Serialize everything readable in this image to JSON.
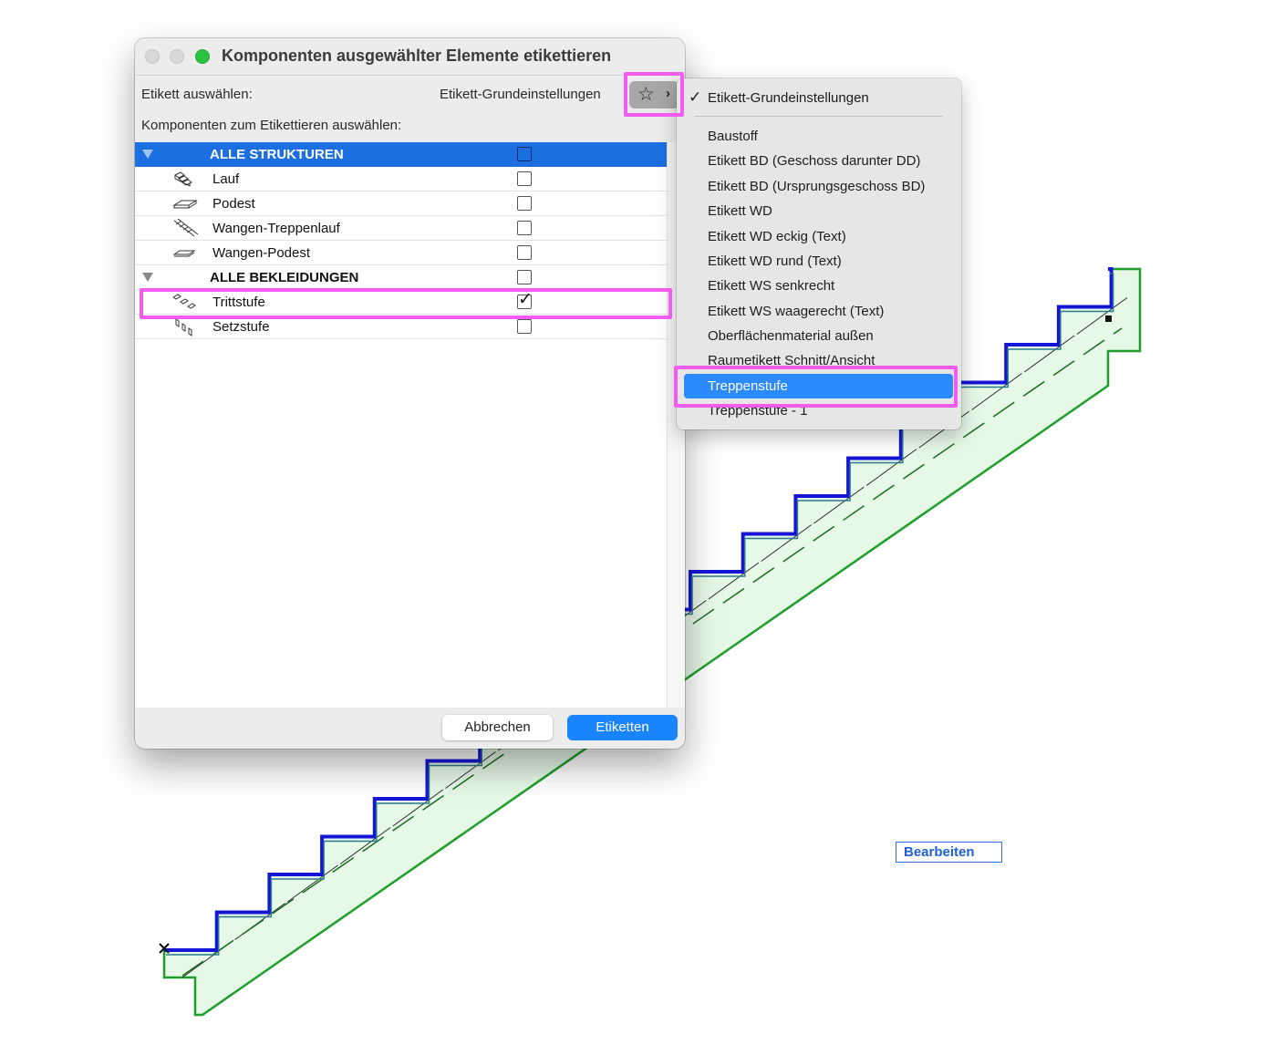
{
  "dialog": {
    "title": "Komponenten ausgewählter Elemente etikettieren",
    "select_label": "Etikett auswählen:",
    "current_label": "Etikett-Grundeinstellungen",
    "components_label": "Komponenten zum Etikettieren auswählen:",
    "rows": [
      {
        "kind": "group",
        "label": "ALLE STRUKTUREN",
        "selected": true,
        "checked": false
      },
      {
        "kind": "item",
        "label": "Lauf",
        "icon": "stair-run-icon",
        "checked": false
      },
      {
        "kind": "item",
        "label": "Podest",
        "icon": "landing-icon",
        "checked": false
      },
      {
        "kind": "item",
        "label": "Wangen-Treppenlauf",
        "icon": "stringer-run-icon",
        "checked": false
      },
      {
        "kind": "item",
        "label": "Wangen-Podest",
        "icon": "stringer-landing-icon",
        "checked": false
      },
      {
        "kind": "group",
        "label": "ALLE BEKLEIDUNGEN",
        "selected": false,
        "checked": false
      },
      {
        "kind": "item",
        "label": "Trittstufe",
        "icon": "tread-icon",
        "checked": true
      },
      {
        "kind": "item",
        "label": "Setzstufe",
        "icon": "riser-icon",
        "checked": false
      }
    ],
    "cancel_label": "Abbrechen",
    "ok_label": "Etiketten"
  },
  "menu": {
    "checked_item": "Etikett-Grundeinstellungen",
    "items": [
      "Baustoff",
      "Etikett BD (Geschoss darunter DD)",
      "Etikett BD (Ursprungsgeschoss BD)",
      "Etikett WD",
      "Etikett WD eckig (Text)",
      "Etikett WD rund (Text)",
      "Etikett WS senkrecht",
      "Etikett WS waagerecht (Text)",
      "Oberflächenmaterial außen",
      "Raumetikett Schnitt/Ansicht",
      "Treppenstufe",
      "Treppenstufe - 1"
    ],
    "highlighted_item": "Treppenstufe"
  },
  "canvas": {
    "edit_label": "Bearbeiten"
  },
  "colors": {
    "stair_fill": "#e6f8e6",
    "stair_outline": "#1e9e2b",
    "tread_line": "#1515d8",
    "selection_blue": "#1b6fe0",
    "primary_button": "#1a84ff",
    "menu_highlight": "#2c8aff",
    "annotation": "#f25cf0"
  }
}
